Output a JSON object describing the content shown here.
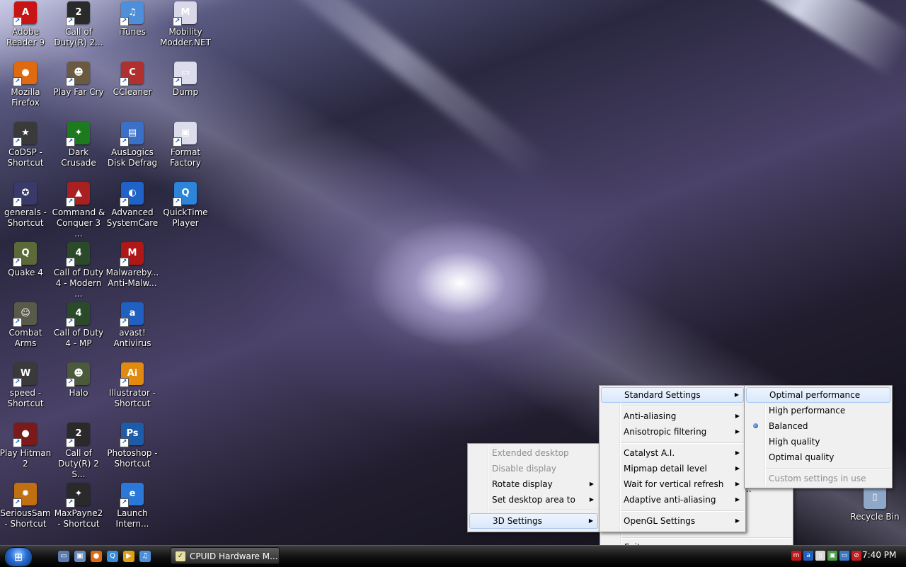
{
  "desktop": {
    "icons": [
      {
        "label": "Adobe Reader 9",
        "color": "#c81414",
        "glyph": "A"
      },
      {
        "label": "Call of Duty(R) 2...",
        "color": "#2a2a2a",
        "glyph": "2"
      },
      {
        "label": "iTunes",
        "color": "#4d8fd8",
        "glyph": "♫"
      },
      {
        "label": "Mobility Modder.NET",
        "color": "#d8d8e8",
        "glyph": "M"
      },
      {
        "label": "Mozilla Firefox",
        "color": "#e06a10",
        "glyph": "●"
      },
      {
        "label": "Play Far Cry",
        "color": "#6a5a40",
        "glyph": "☻"
      },
      {
        "label": "CCleaner",
        "color": "#b03030",
        "glyph": "C"
      },
      {
        "label": "Dump",
        "color": "#dcdcec",
        "glyph": "▭"
      },
      {
        "label": "CoDSP - Shortcut",
        "color": "#3a3a3a",
        "glyph": "★"
      },
      {
        "label": "Dark Crusade",
        "color": "#1e7a1e",
        "glyph": "✦"
      },
      {
        "label": "AusLogics Disk Defrag",
        "color": "#3a70c8",
        "glyph": "▤"
      },
      {
        "label": "Format Factory",
        "color": "#dcdcec",
        "glyph": "▣"
      },
      {
        "label": "generals - Shortcut",
        "color": "#3a3a6a",
        "glyph": "✪"
      },
      {
        "label": "Command & Conquer 3 ...",
        "color": "#a82020",
        "glyph": "▲"
      },
      {
        "label": "Advanced SystemCare",
        "color": "#1f63c8",
        "glyph": "◐"
      },
      {
        "label": "QuickTime Player",
        "color": "#2d84d8",
        "glyph": "Q"
      },
      {
        "label": "Quake 4",
        "color": "#5c6a3a",
        "glyph": "Q"
      },
      {
        "label": "Call of Duty 4 - Modern ...",
        "color": "#2a4a2a",
        "glyph": "4"
      },
      {
        "label": "Malwareby... Anti-Malw...",
        "color": "#b01818",
        "glyph": "M"
      },
      {
        "label": "Combat Arms",
        "color": "#5a5a4a",
        "glyph": "☺"
      },
      {
        "label": "Call of Duty 4 - MP",
        "color": "#2a4a2a",
        "glyph": "4"
      },
      {
        "label": "avast! Antivirus",
        "color": "#2060c0",
        "glyph": "a"
      },
      {
        "label": "speed - Shortcut",
        "color": "#3a3a3a",
        "glyph": "W"
      },
      {
        "label": "Halo",
        "color": "#4a5a3a",
        "glyph": "☻"
      },
      {
        "label": "Illustrator - Shortcut",
        "color": "#e08a10",
        "glyph": "Ai"
      },
      {
        "label": "Play Hitman 2",
        "color": "#7a1a1a",
        "glyph": "●"
      },
      {
        "label": "Call of Duty(R) 2 S...",
        "color": "#2a2a2a",
        "glyph": "2"
      },
      {
        "label": "Photoshop - Shortcut",
        "color": "#1f5ca8",
        "glyph": "Ps"
      },
      {
        "label": "SeriousSam - Shortcut",
        "color": "#c07010",
        "glyph": "✹"
      },
      {
        "label": "MaxPayne2 - Shortcut",
        "color": "#2a2a2a",
        "glyph": "✦"
      },
      {
        "label": "Launch Intern...",
        "color": "#2a78d8",
        "glyph": "e"
      },
      {
        "label": "Recycle Bin",
        "color": "#8fa8c8",
        "glyph": "▯"
      }
    ]
  },
  "menu_display": {
    "items": [
      {
        "label": "Extended desktop",
        "disabled": true
      },
      {
        "label": "Disable display",
        "disabled": true
      },
      {
        "label": "Rotate display",
        "arrow": "▶"
      },
      {
        "label": "Set desktop area to",
        "arrow": "▶"
      },
      {
        "label": "3D Settings",
        "arrow": "▶"
      }
    ]
  },
  "menu_main": {
    "exit_label": "Exit",
    "partial_char": ".."
  },
  "menu_3d": {
    "items": [
      {
        "label": "Standard Settings",
        "arrow": "▶"
      },
      {
        "label": "Anti-aliasing",
        "arrow": "▶"
      },
      {
        "label": "Anisotropic filtering",
        "arrow": "▶"
      },
      {
        "label": "Catalyst A.I.",
        "arrow": "▶"
      },
      {
        "label": "Mipmap detail level",
        "arrow": "▶"
      },
      {
        "label": "Wait for vertical refresh",
        "arrow": "▶"
      },
      {
        "label": "Adaptive anti-aliasing",
        "arrow": "▶"
      },
      {
        "label": "OpenGL Settings",
        "arrow": "▶"
      }
    ]
  },
  "menu_standard": {
    "items": [
      {
        "label": "Optimal performance"
      },
      {
        "label": "High performance"
      },
      {
        "label": "Balanced",
        "selected": true
      },
      {
        "label": "High quality"
      },
      {
        "label": "Optimal quality"
      },
      {
        "label": "Custom settings in use",
        "disabled": true
      }
    ]
  },
  "taskbar": {
    "start_glyph": "⊞",
    "quicklaunch": [
      {
        "name": "show-desktop",
        "color": "#5a7ab0",
        "glyph": "▭"
      },
      {
        "name": "switch-windows",
        "color": "#6a8ab8",
        "glyph": "▣"
      },
      {
        "name": "firefox",
        "color": "#e06a10",
        "glyph": "●"
      },
      {
        "name": "search",
        "color": "#3a8ad8",
        "glyph": "Q"
      },
      {
        "name": "media",
        "color": "#e0a010",
        "glyph": "▶"
      },
      {
        "name": "itunes",
        "color": "#4d8fd8",
        "glyph": "♫"
      }
    ],
    "task_button_label": "CPUID Hardware M...",
    "tray": [
      {
        "name": "malwarebytes",
        "color": "#c01818",
        "glyph": "m"
      },
      {
        "name": "avast",
        "color": "#2060c0",
        "glyph": "a"
      },
      {
        "name": "network",
        "color": "#d8d8d8",
        "glyph": "▯"
      },
      {
        "name": "monitor",
        "color": "#4a9a4a",
        "glyph": "▣"
      },
      {
        "name": "display",
        "color": "#3a78c8",
        "glyph": "▭"
      },
      {
        "name": "volume-muted",
        "color": "#c02020",
        "glyph": "⊘"
      }
    ],
    "clock": "7:40 PM"
  }
}
